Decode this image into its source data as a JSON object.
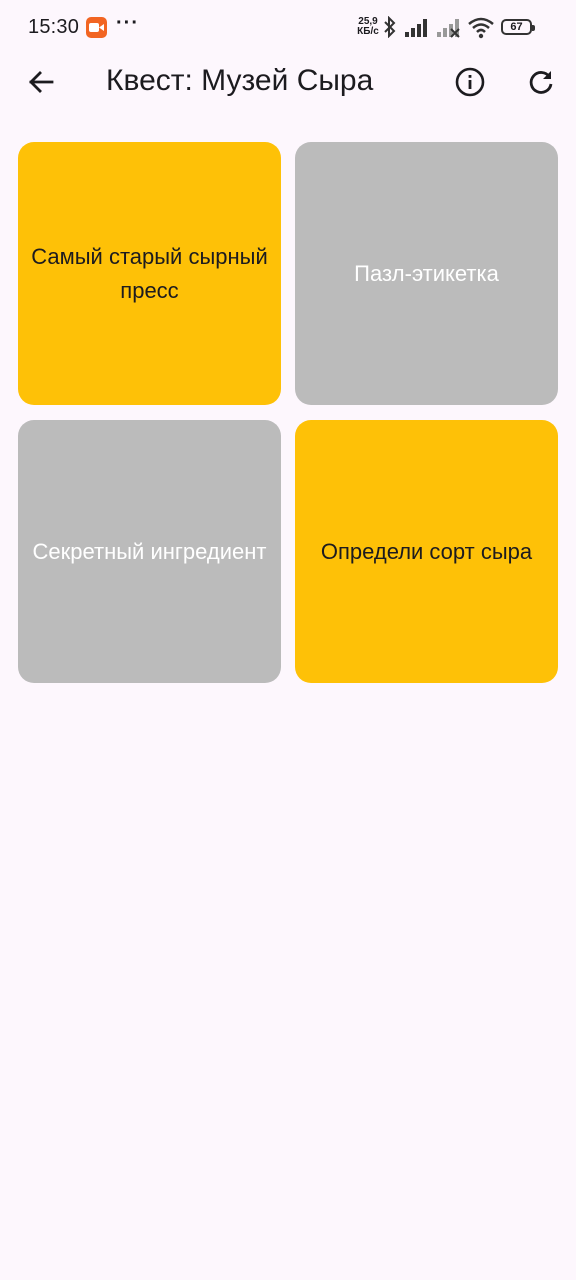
{
  "status_bar": {
    "time": "15:30",
    "speed_value": "25,9",
    "speed_unit": "КБ/с",
    "battery": "67",
    "icons": [
      "screen-record-icon",
      "more-dots-icon",
      "bluetooth-icon",
      "signal-icon",
      "signal-empty-icon",
      "wifi-icon",
      "battery-icon"
    ]
  },
  "app_bar": {
    "title": "Квест: Музей Сыра",
    "icons": [
      "back-arrow-icon",
      "info-icon",
      "refresh-icon"
    ]
  },
  "tiles": [
    {
      "label": "Самый старый сырный пресс",
      "state": "active",
      "color": "#fec107"
    },
    {
      "label": "Пазл-этикетка",
      "state": "locked",
      "color": "#bbbbbb"
    },
    {
      "label": "Секретный ингредиент",
      "state": "locked",
      "color": "#bbbbbb"
    },
    {
      "label": "Определи сорт сыра",
      "state": "active",
      "color": "#fec107"
    }
  ],
  "colors": {
    "background": "#fdf7fd",
    "active_tile": "#fec107",
    "locked_tile": "#bbbbbb",
    "text": "#1c1b1f"
  }
}
